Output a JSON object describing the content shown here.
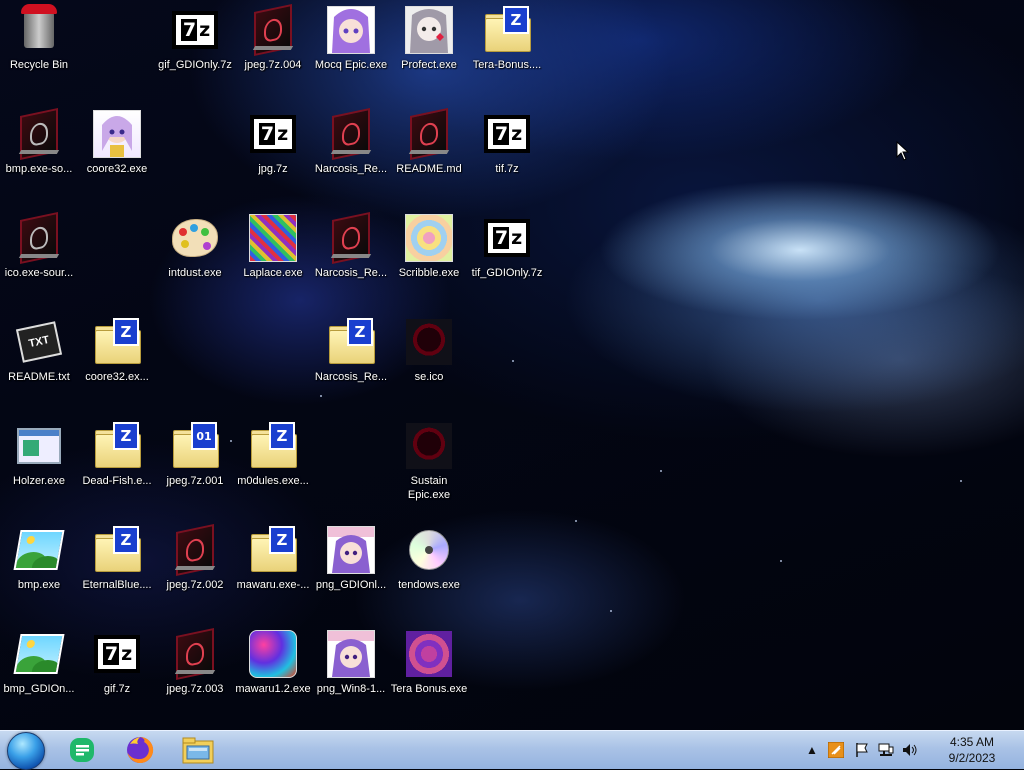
{
  "desktop": {
    "icons": [
      {
        "label": "Recycle Bin"
      },
      {
        "label": "gif_GDIOnly.7z"
      },
      {
        "label": "jpeg.7z.004"
      },
      {
        "label": "Mocq Epic.exe"
      },
      {
        "label": "Profect.exe"
      },
      {
        "label": "Tera-Bonus...."
      },
      {
        "label": "bmp.exe-so..."
      },
      {
        "label": "coore32.exe"
      },
      {
        "label": "jpg.7z"
      },
      {
        "label": "Narcosis_Re..."
      },
      {
        "label": "README.md"
      },
      {
        "label": "tif.7z"
      },
      {
        "label": "ico.exe-sour..."
      },
      {
        "label": "intdust.exe"
      },
      {
        "label": "Laplace.exe"
      },
      {
        "label": "Narcosis_Re..."
      },
      {
        "label": "Scribble.exe"
      },
      {
        "label": "tif_GDIOnly.7z"
      },
      {
        "label": "README.txt"
      },
      {
        "label": "coore32.ex..."
      },
      {
        "label": "Narcosis_Re..."
      },
      {
        "label": "se.ico"
      },
      {
        "label": "Holzer.exe"
      },
      {
        "label": "Dead-Fish.e..."
      },
      {
        "label": "jpeg.7z.001"
      },
      {
        "label": "m0dules.exe..."
      },
      {
        "label": "Sustain Epic.exe"
      },
      {
        "label": "bmp.exe"
      },
      {
        "label": "EternalBlue...."
      },
      {
        "label": "jpeg.7z.002"
      },
      {
        "label": "mawaru.exe-..."
      },
      {
        "label": "png_GDIOnl..."
      },
      {
        "label": "tendows.exe"
      },
      {
        "label": "bmp_GDIOn..."
      },
      {
        "label": "gif.7z"
      },
      {
        "label": "jpeg.7z.003"
      },
      {
        "label": "mawaru1.2.exe"
      },
      {
        "label": "png_Win8-1..."
      },
      {
        "label": "Tera Bonus.exe"
      }
    ]
  },
  "icon_names": {
    "recycle": "recycle-bin-icon",
    "sevenzip": "7z-archive-icon",
    "zip": "zip-folder-icon",
    "dark_exe": "dark-exe-icon",
    "picture": "picture-icon",
    "image": "image-file-icon",
    "text": "text-file-icon"
  },
  "taskbar": {
    "start": "start-orb-icon",
    "pinned": [
      "notes-app-icon",
      "firefox-icon",
      "file-explorer-icon"
    ],
    "tray": {
      "show_hidden": "▲",
      "clock_time": "4:35 AM",
      "clock_date": "9/2/2023"
    }
  },
  "colors": {
    "taskbar_top": "#c7d9f0",
    "taskbar_bottom": "#95b3df",
    "label_text": "#ffffff"
  }
}
